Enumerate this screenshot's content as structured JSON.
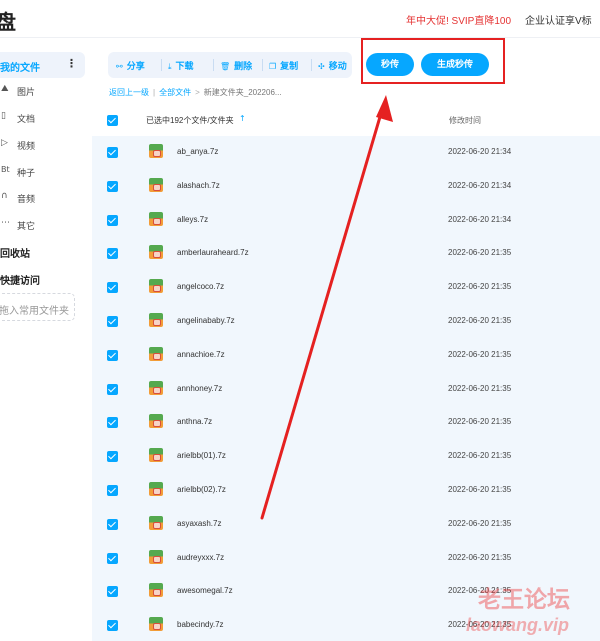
{
  "header": {
    "logo_char": "盘",
    "promo": "年中大促! SVIP直降100",
    "cert": "企业认证享V标"
  },
  "sidebar": {
    "my_files": "我的文件",
    "more": "⋮",
    "items": [
      {
        "icon": "image-icon",
        "glyph": "⛰",
        "label": "图片"
      },
      {
        "icon": "document-icon",
        "glyph": "▯",
        "label": "文档"
      },
      {
        "icon": "video-icon",
        "glyph": "▷",
        "label": "视频"
      },
      {
        "icon": "torrent-icon",
        "glyph": "Bt",
        "label": "种子"
      },
      {
        "icon": "audio-icon",
        "glyph": "∩",
        "label": "音频"
      },
      {
        "icon": "other-icon",
        "glyph": "⋯",
        "label": "其它"
      }
    ],
    "recycle": "回收站",
    "quick_access": "快捷访问",
    "add_folder": "拖入常用文件夹"
  },
  "toolbar": {
    "share": "分享",
    "download": "下载",
    "delete": "删除",
    "copy": "复制",
    "move": "移动",
    "instant": "秒传",
    "gen_instant": "生成秒传"
  },
  "breadcrumb": {
    "back": "返回上一级",
    "all": "全部文件",
    "current": "新建文件夹_202206..."
  },
  "list_header": {
    "selected": "已选中192个文件/文件夹",
    "sort_icon": "↑",
    "modified": "修改时间"
  },
  "files": [
    {
      "name": "ab_anya.7z",
      "time": "2022-06-20 21:34"
    },
    {
      "name": "alashach.7z",
      "time": "2022-06-20 21:34"
    },
    {
      "name": "alleys.7z",
      "time": "2022-06-20 21:34"
    },
    {
      "name": "amberlauraheard.7z",
      "time": "2022-06-20 21:35"
    },
    {
      "name": "angelcoco.7z",
      "time": "2022-06-20 21:35"
    },
    {
      "name": "angelinababy.7z",
      "time": "2022-06-20 21:35"
    },
    {
      "name": "annachioe.7z",
      "time": "2022-06-20 21:35"
    },
    {
      "name": "annhoney.7z",
      "time": "2022-06-20 21:35"
    },
    {
      "name": "anthna.7z",
      "time": "2022-06-20 21:35"
    },
    {
      "name": "arielbb(01).7z",
      "time": "2022-06-20 21:35"
    },
    {
      "name": "arielbb(02).7z",
      "time": "2022-06-20 21:35"
    },
    {
      "name": "asyaxash.7z",
      "time": "2022-06-20 21:35"
    },
    {
      "name": "audreyxxx.7z",
      "time": "2022-06-20 21:35"
    },
    {
      "name": "awesomegal.7z",
      "time": "2022-06-20 21:35"
    },
    {
      "name": "babecindy.7z",
      "time": "2022-06-20 21:35"
    }
  ],
  "watermark": {
    "line1": "老王论坛",
    "line2": "laowang.vip"
  },
  "colors": {
    "accent": "#06a7ff",
    "annotation": "#e52121",
    "promo": "#e53333"
  }
}
